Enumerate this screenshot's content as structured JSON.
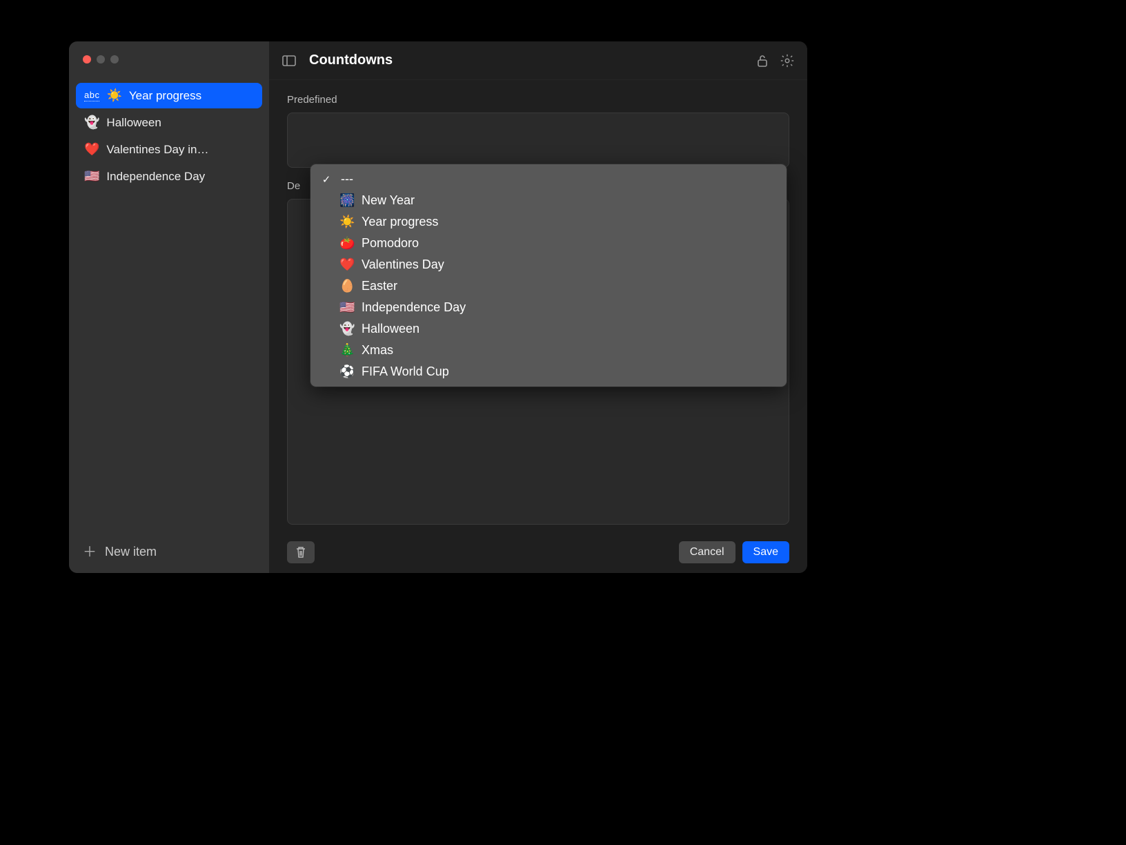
{
  "titlebar": {
    "title": "Countdowns"
  },
  "sidebar": {
    "items": [
      {
        "abc": "abc",
        "emoji": "☀️",
        "label": "Year progress",
        "selected": true
      },
      {
        "emoji": "👻",
        "label": "Halloween",
        "selected": false
      },
      {
        "emoji": "❤️",
        "label": "Valentines Day in…",
        "selected": false
      },
      {
        "emoji": "🇺🇸",
        "label": "Independence Day",
        "selected": false
      }
    ],
    "new_item_label": "New item"
  },
  "content": {
    "predefined_label": "Predefined",
    "details_label_partial": "De"
  },
  "dropdown": {
    "items": [
      {
        "checked": true,
        "emoji": "",
        "label": "---"
      },
      {
        "checked": false,
        "emoji": "🎆",
        "label": "New Year"
      },
      {
        "checked": false,
        "emoji": "☀️",
        "label": "Year progress"
      },
      {
        "checked": false,
        "emoji": "🍅",
        "label": "Pomodoro"
      },
      {
        "checked": false,
        "emoji": "❤️",
        "label": "Valentines Day"
      },
      {
        "checked": false,
        "emoji": "🥚",
        "label": "Easter"
      },
      {
        "checked": false,
        "emoji": "🇺🇸",
        "label": "Independence Day"
      },
      {
        "checked": false,
        "emoji": "👻",
        "label": "Halloween"
      },
      {
        "checked": false,
        "emoji": "🎄",
        "label": "Xmas"
      },
      {
        "checked": false,
        "emoji": "⚽",
        "label": "FIFA World Cup"
      }
    ]
  },
  "footer": {
    "cancel_label": "Cancel",
    "save_label": "Save"
  }
}
